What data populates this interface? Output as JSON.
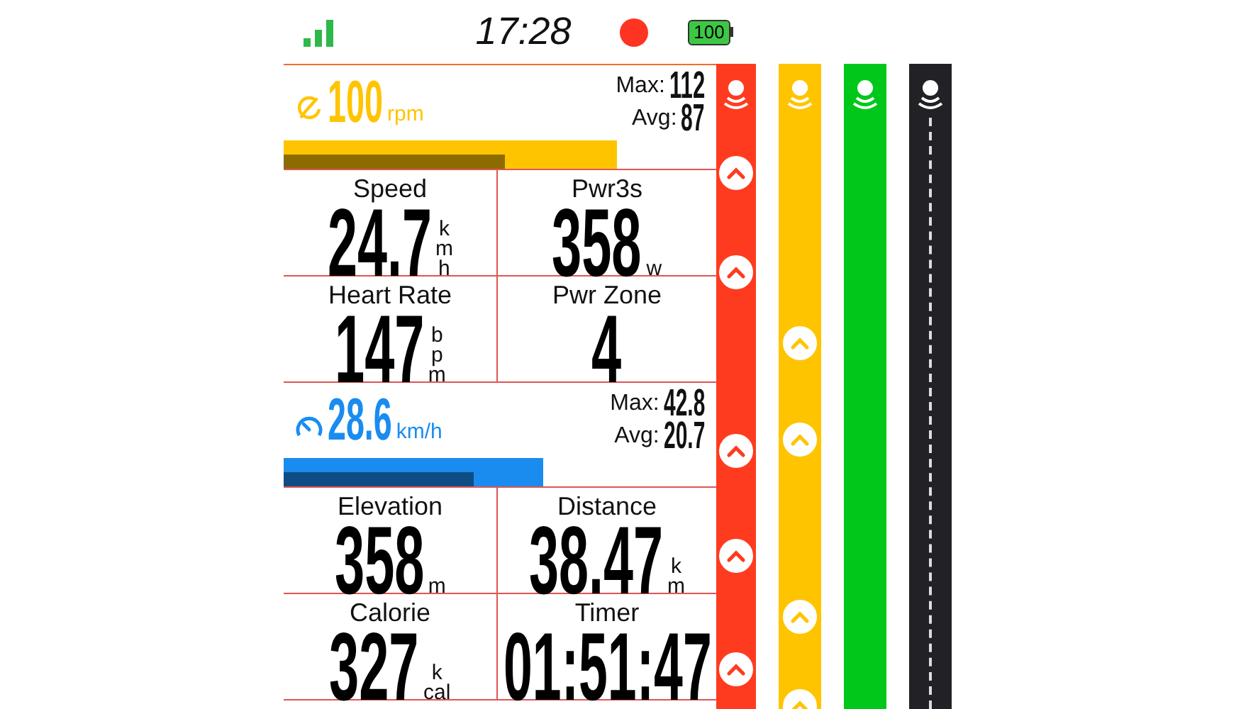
{
  "status_bar": {
    "time": "17:28",
    "recording": true,
    "battery": "100"
  },
  "panels": [
    {
      "kind": "cadence",
      "color": "#ffc400",
      "value": "100",
      "unit": "rpm",
      "stats": [
        {
          "label": "Max:",
          "value": "112"
        },
        {
          "label": "Avg:",
          "value": "87"
        }
      ],
      "bar": {
        "level": 0.77
      },
      "avg_bar": {
        "level": 0.51
      }
    },
    {
      "kind": "grid",
      "cells": [
        {
          "label": "Speed",
          "value": "24.7",
          "unit": [
            "k",
            "m",
            "h"
          ]
        },
        {
          "label": "Pwr3s",
          "value": "358",
          "unit": [
            "w"
          ]
        },
        {
          "label": "Heart Rate",
          "value": "147",
          "unit": [
            "b",
            "p",
            "m"
          ]
        },
        {
          "label": "Pwr Zone",
          "value": "4"
        }
      ]
    },
    {
      "kind": "speed",
      "color": "#1a8cf0",
      "value": "28.6",
      "unit": "km/h",
      "stats": [
        {
          "label": "Max:",
          "value": "42.8"
        },
        {
          "label": "Avg:",
          "value": "20.7"
        }
      ],
      "bar": {
        "level": 0.6
      },
      "avg_bar": {
        "level": 0.44
      }
    },
    {
      "kind": "grid",
      "cells": [
        {
          "label": "Elevation",
          "value": "358",
          "unit": [
            "m"
          ]
        },
        {
          "label": "Distance",
          "value": "38.47",
          "unit": [
            "k",
            "m"
          ]
        },
        {
          "label": "Calorie",
          "value": "327",
          "unit": [
            "k",
            "cal"
          ]
        },
        {
          "label": "Timer",
          "value": "01:51:47"
        }
      ]
    }
  ],
  "strips": [
    {
      "kind": "solid",
      "color": "#ff3b1f",
      "chevrons": [
        {
          "kind": "up"
        },
        {
          "kind": "up"
        },
        {
          "kind": "up"
        },
        {
          "kind": "up"
        },
        {
          "kind": "up"
        }
      ]
    },
    {
      "kind": "solid",
      "color": "#ffc400",
      "chevrons": [
        {
          "kind": "up"
        },
        {
          "kind": "up"
        },
        {
          "kind": "up"
        },
        {
          "kind": "up"
        }
      ]
    },
    {
      "kind": "solid",
      "color": "#00c81a"
    },
    {
      "kind": "route",
      "color": "#222226"
    }
  ]
}
